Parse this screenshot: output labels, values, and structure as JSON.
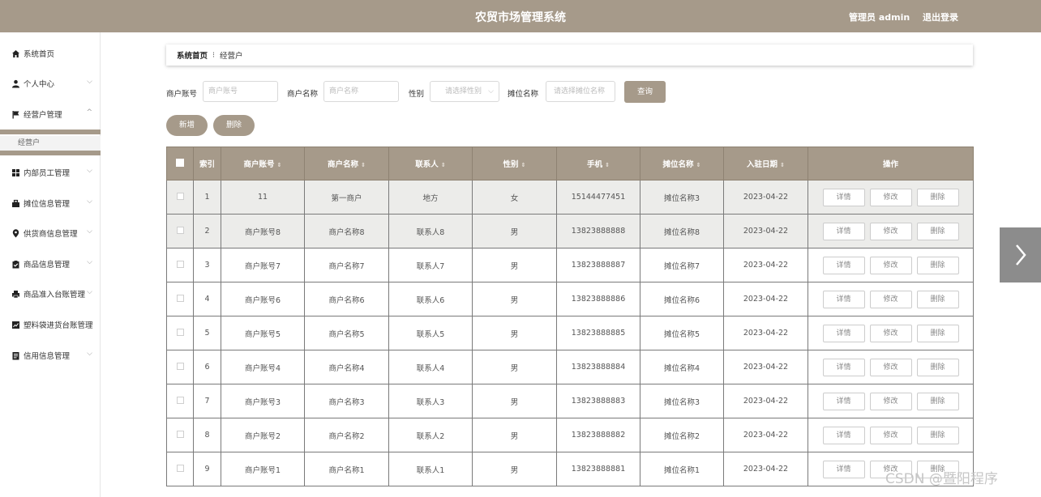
{
  "header": {
    "title": "农贸市场管理系统",
    "user_label": "管理员 admin",
    "logout_label": "退出登录"
  },
  "sidebar": {
    "items": [
      {
        "label": "系统首页",
        "icon": "home-icon"
      },
      {
        "label": "个人中心",
        "icon": "user-icon"
      },
      {
        "label": "经营户管理",
        "icon": "flag-icon"
      },
      {
        "label": "内部员工管理",
        "icon": "grid-icon"
      },
      {
        "label": "摊位信息管理",
        "icon": "briefcase-icon"
      },
      {
        "label": "供货商信息管理",
        "icon": "location-pin-icon"
      },
      {
        "label": "商品信息管理",
        "icon": "clipboard-icon"
      },
      {
        "label": "商品准入台账管理",
        "icon": "printer-icon"
      },
      {
        "label": "塑料袋进货台账管理",
        "icon": "chart-icon"
      },
      {
        "label": "信用信息管理",
        "icon": "document-icon"
      }
    ],
    "submenu_label": "经营户"
  },
  "breadcrumb": {
    "home": "系统首页",
    "separator": "⁝",
    "current": "经营户"
  },
  "filters": {
    "merchant_account_label": "商户账号",
    "merchant_account_placeholder": "商户账号",
    "merchant_name_label": "商户名称",
    "merchant_name_placeholder": "商户名称",
    "gender_label": "性别",
    "gender_placeholder": "请选择性别",
    "stall_label": "摊位名称",
    "stall_placeholder": "请选择摊位名称",
    "query_label": "查询"
  },
  "actions": {
    "add_label": "新增",
    "delete_label": "删除"
  },
  "table": {
    "columns": [
      "索引",
      "商户账号",
      "商户名称",
      "联系人",
      "性别",
      "手机",
      "摊位名称",
      "入驻日期",
      "操作"
    ],
    "row_buttons": {
      "detail": "详情",
      "edit": "修改",
      "delete": "删除"
    },
    "rows": [
      {
        "index": "1",
        "account": "11",
        "name": "第一商户",
        "contact": "地方",
        "gender": "女",
        "phone": "15144477451",
        "stall": "摊位名称3",
        "date": "2023-04-22"
      },
      {
        "index": "2",
        "account": "商户账号8",
        "name": "商户名称8",
        "contact": "联系人8",
        "gender": "男",
        "phone": "13823888888",
        "stall": "摊位名称8",
        "date": "2023-04-22"
      },
      {
        "index": "3",
        "account": "商户账号7",
        "name": "商户名称7",
        "contact": "联系人7",
        "gender": "男",
        "phone": "13823888887",
        "stall": "摊位名称7",
        "date": "2023-04-22"
      },
      {
        "index": "4",
        "account": "商户账号6",
        "name": "商户名称6",
        "contact": "联系人6",
        "gender": "男",
        "phone": "13823888886",
        "stall": "摊位名称6",
        "date": "2023-04-22"
      },
      {
        "index": "5",
        "account": "商户账号5",
        "name": "商户名称5",
        "contact": "联系人5",
        "gender": "男",
        "phone": "13823888885",
        "stall": "摊位名称5",
        "date": "2023-04-22"
      },
      {
        "index": "6",
        "account": "商户账号4",
        "name": "商户名称4",
        "contact": "联系人4",
        "gender": "男",
        "phone": "13823888884",
        "stall": "摊位名称4",
        "date": "2023-04-22"
      },
      {
        "index": "7",
        "account": "商户账号3",
        "name": "商户名称3",
        "contact": "联系人3",
        "gender": "男",
        "phone": "13823888883",
        "stall": "摊位名称3",
        "date": "2023-04-22"
      },
      {
        "index": "8",
        "account": "商户账号2",
        "name": "商户名称2",
        "contact": "联系人2",
        "gender": "男",
        "phone": "13823888882",
        "stall": "摊位名称2",
        "date": "2023-04-22"
      },
      {
        "index": "9",
        "account": "商户账号1",
        "name": "商户名称1",
        "contact": "联系人1",
        "gender": "男",
        "phone": "13823888881",
        "stall": "摊位名称1",
        "date": "2023-04-22"
      }
    ]
  },
  "watermark": "CSDN @暨阳程序",
  "colors": {
    "accent": "#a69a8a"
  }
}
